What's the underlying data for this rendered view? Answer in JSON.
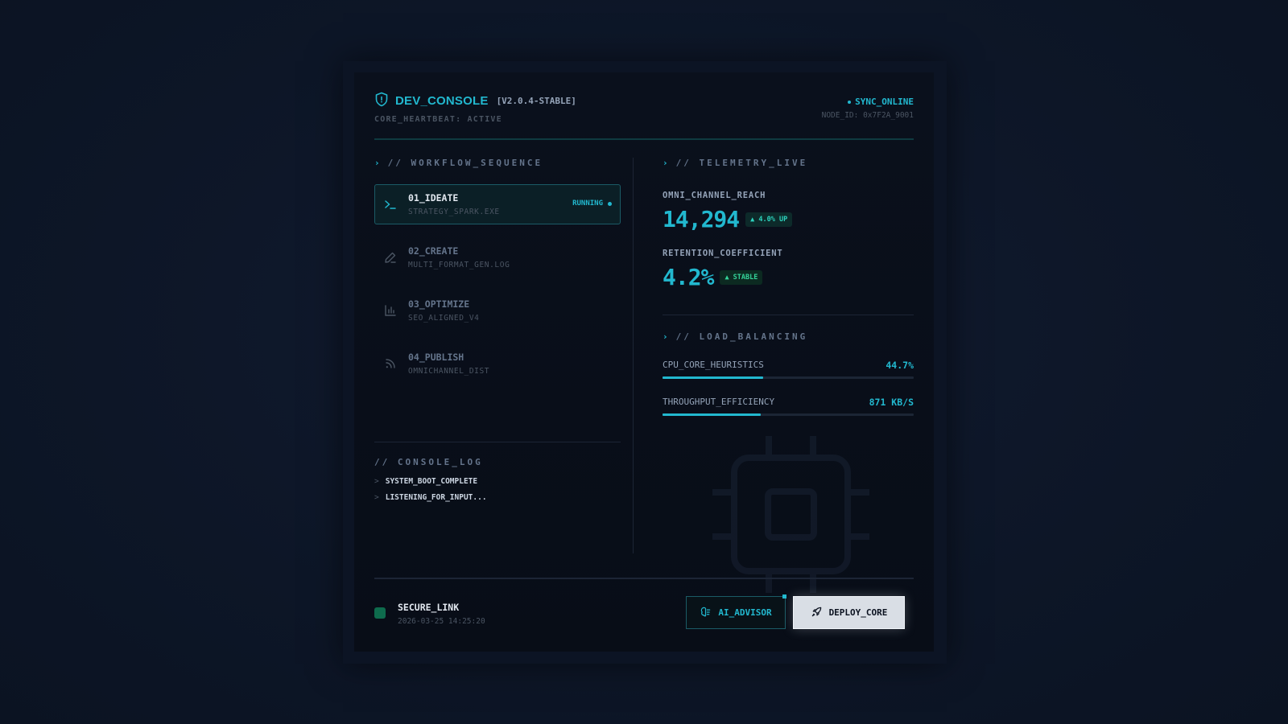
{
  "header": {
    "title": "DEV_CONSOLE",
    "version": "[V2.0.4-STABLE]",
    "heartbeat": "CORE_HEARTBEAT: ACTIVE",
    "sync_status": "SYNC_ONLINE",
    "node_id": "NODE_ID: 0x7F2A_9001"
  },
  "workflow": {
    "section_title": "// WORKFLOW_SEQUENCE",
    "items": [
      {
        "name": "01_IDEATE",
        "sub": "STRATEGY_SPARK.EXE",
        "status": "RUNNING",
        "icon": "terminal-icon"
      },
      {
        "name": "02_CREATE",
        "sub": "MULTI_FORMAT_GEN.LOG",
        "status": "",
        "icon": "pencil-icon"
      },
      {
        "name": "03_OPTIMIZE",
        "sub": "SEO_ALIGNED_V4",
        "status": "",
        "icon": "bar-chart-icon"
      },
      {
        "name": "04_PUBLISH",
        "sub": "OMNICHANNEL_DIST",
        "status": "",
        "icon": "rss-icon"
      }
    ]
  },
  "console": {
    "section_title": "// CONSOLE_LOG",
    "lines": [
      "SYSTEM_BOOT_COMPLETE",
      "LISTENING_FOR_INPUT..."
    ],
    "prompt": ">"
  },
  "telemetry": {
    "section_title": "// TELEMETRY_LIVE",
    "metrics": [
      {
        "label": "OMNI_CHANNEL_REACH",
        "value": "14,294",
        "badge": "▲ 4.0% UP"
      },
      {
        "label": "RETENTION_COEFFICIENT",
        "value": "4.2%",
        "badge": "▲ STABLE"
      }
    ]
  },
  "load_balancing": {
    "section_title": "// LOAD_BALANCING",
    "bars": [
      {
        "label": "CPU_CORE_HEURISTICS",
        "value": "44.7%",
        "fill": 0.4
      },
      {
        "label": "THROUGHPUT_EFFICIENCY",
        "value": "871 KB/S",
        "fill": 0.39
      }
    ]
  },
  "footer": {
    "link_name": "SECURE_LINK",
    "timestamp": "2026-03-25 14:25:20",
    "advisor_label": "AI_ADVISOR",
    "deploy_label": "DEPLOY_CORE"
  },
  "colors": {
    "accent": "#22b8cf",
    "success": "#34d399",
    "background": "#0f172a"
  }
}
